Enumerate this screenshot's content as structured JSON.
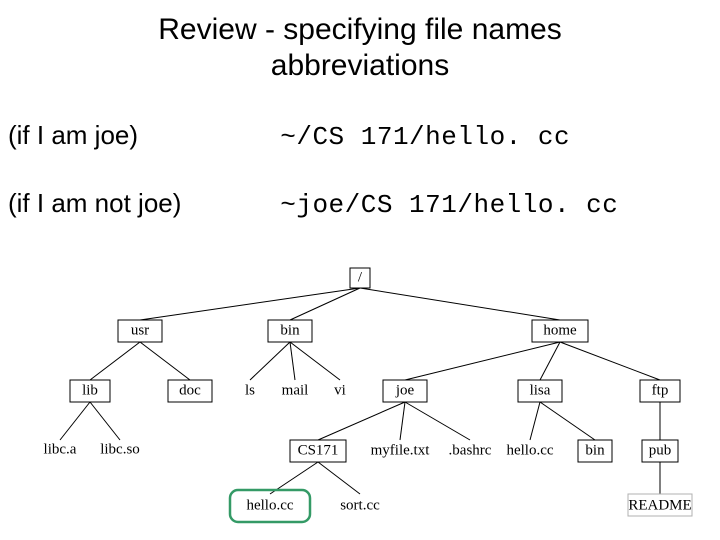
{
  "title_line1": "Review - specifying file names",
  "title_line2": "abbreviations",
  "rows": [
    {
      "cond": "(if I am joe)",
      "path": "~/CS 171/hello. cc"
    },
    {
      "cond": "(if I am not joe)",
      "path": "~joe/CS 171/hello. cc"
    }
  ],
  "tree": {
    "root": "/",
    "usr": {
      "label": "usr",
      "children": {
        "lib": "lib",
        "doc": "doc"
      }
    },
    "bin": {
      "label": "bin",
      "children": {
        "ls": "ls",
        "mail": "mail",
        "vi": "vi"
      }
    },
    "home": {
      "label": "home"
    },
    "joe": {
      "label": "joe",
      "children": {
        "cs171": "CS171",
        "myfile": "myfile.txt",
        "bashrc": ".bashrc"
      }
    },
    "lisa": {
      "label": "lisa",
      "children": {
        "hellocc": "hello.cc",
        "bin": "bin"
      }
    },
    "ftp": {
      "label": "ftp",
      "children": {
        "pub": "pub"
      }
    },
    "libc_a": "libc.a",
    "libc_so": "libc.so",
    "hello_cc": "hello.cc",
    "sort_cc": "sort.cc",
    "readme": "README"
  }
}
